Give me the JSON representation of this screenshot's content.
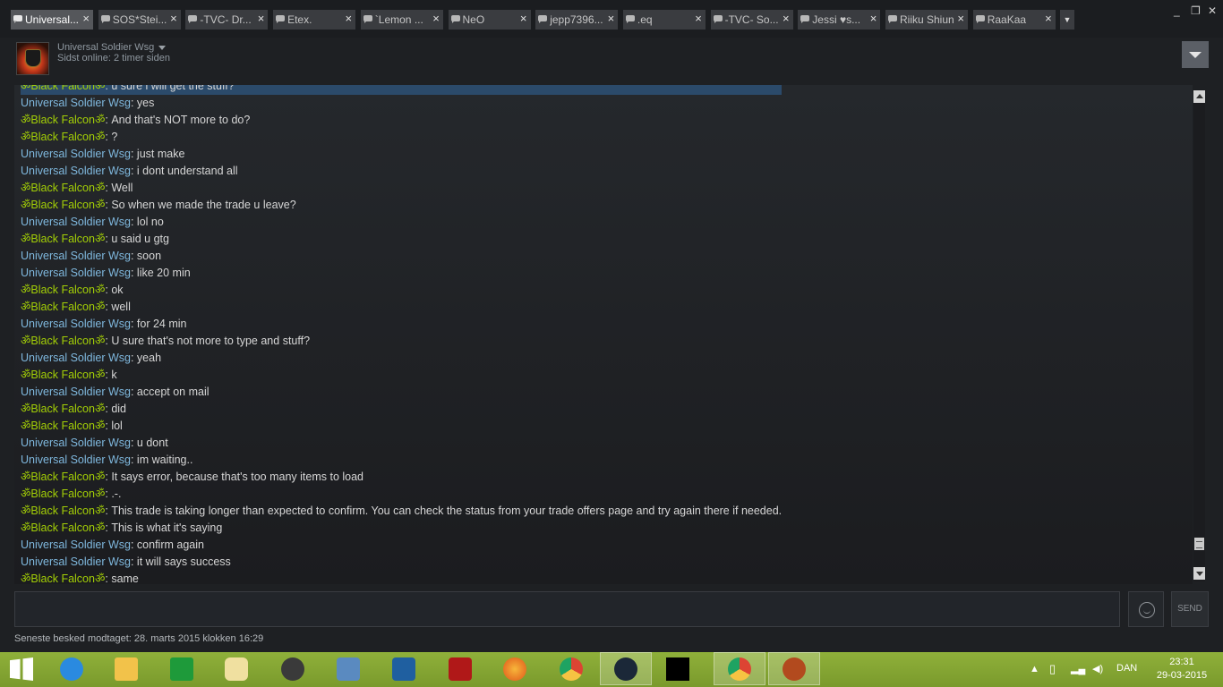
{
  "tabs": [
    {
      "label": "Universal...",
      "active": true
    },
    {
      "label": "SOS*Stei..."
    },
    {
      "label": "-TVC- Dr..."
    },
    {
      "label": "Etex."
    },
    {
      "label": "`Lemon ..."
    },
    {
      "label": "NeO"
    },
    {
      "label": "jepp7396..."
    },
    {
      "label": ".eq"
    },
    {
      "label": "-TVC- So..."
    },
    {
      "label": "Jessi ♥s..."
    },
    {
      "label": "Riiku Shiun"
    },
    {
      "label": "RaaKaa"
    }
  ],
  "window": {
    "minimize": "_",
    "restore": "❐",
    "close": "✕"
  },
  "header": {
    "name": "Universal Soldier Wsg",
    "status": "Sidst online: 2 timer siden"
  },
  "speakers": {
    "self": "Universal Soldier Wsg",
    "friend": "ॐBlack Falconॐ"
  },
  "messages": [
    {
      "s": "friend",
      "t": "u sure i will get the stuff?",
      "hl": true
    },
    {
      "s": "self",
      "t": "yes"
    },
    {
      "s": "friend",
      "t": "And that's NOT more to do?"
    },
    {
      "s": "friend",
      "t": "?"
    },
    {
      "s": "self",
      "t": "just make"
    },
    {
      "s": "self",
      "t": "i dont understand all"
    },
    {
      "s": "friend",
      "t": "Well"
    },
    {
      "s": "friend",
      "t": "So when we made the trade u leave?"
    },
    {
      "s": "self",
      "t": "lol no"
    },
    {
      "s": "friend",
      "t": "u said u gtg"
    },
    {
      "s": "self",
      "t": "soon"
    },
    {
      "s": "self",
      "t": "like 20 min"
    },
    {
      "s": "friend",
      "t": "ok"
    },
    {
      "s": "friend",
      "t": "well"
    },
    {
      "s": "self",
      "t": "for 24 min"
    },
    {
      "s": "friend",
      "t": "U sure that's not more to type and stuff?"
    },
    {
      "s": "self",
      "t": "yeah"
    },
    {
      "s": "friend",
      "t": "k"
    },
    {
      "s": "self",
      "t": "accept on mail"
    },
    {
      "s": "friend",
      "t": "did"
    },
    {
      "s": "friend",
      "t": "lol"
    },
    {
      "s": "self",
      "t": "u dont"
    },
    {
      "s": "self",
      "t": "im waiting.."
    },
    {
      "s": "friend",
      "t": "It says error, because that's too many items to load"
    },
    {
      "s": "friend",
      "t": ".-."
    },
    {
      "s": "friend",
      "t": "This trade is taking longer than expected to confirm. You can check the status from your trade offers page and try again there if needed."
    },
    {
      "s": "friend",
      "t": "This is what it's saying"
    },
    {
      "s": "self",
      "t": "confirm again"
    },
    {
      "s": "self",
      "t": "it will says success"
    },
    {
      "s": "friend",
      "t": "same"
    }
  ],
  "input": {
    "placeholder": "",
    "value": "",
    "send_label": "SEND"
  },
  "footer": {
    "last_received": "Seneste besked modtaget: 28. marts 2015 klokken 16:29"
  },
  "taskbar": {
    "icons": [
      "windows-start-icon",
      "internet-explorer-icon",
      "file-explorer-icon",
      "windows-store-icon",
      "disk-utility-icon",
      "speaker-app-icon",
      "doc-scanner-icon",
      "settings-app-icon",
      "power-app-icon",
      "firefox-icon",
      "chrome-icon",
      "steam-icon",
      "command-prompt-icon",
      "chrome-icon",
      "tf2-icon"
    ],
    "language": "DAN",
    "time": "23:31",
    "date": "29-03-2015"
  },
  "colors": {
    "self_name": "#7fb8de",
    "friend_name": "#a3cf06",
    "taskbar": "#8fb03a"
  }
}
